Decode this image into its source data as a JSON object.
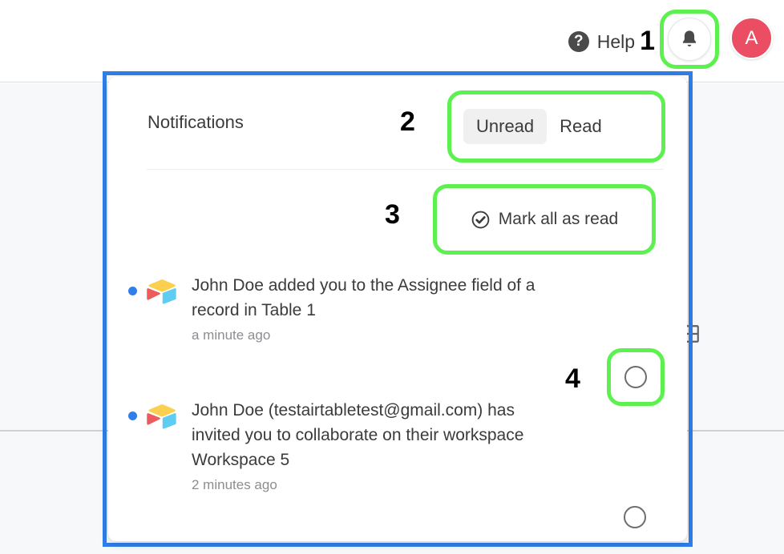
{
  "topbar": {
    "help_icon": "question-mark-circle-icon",
    "help_label": "Help",
    "step_1": "1",
    "bell_icon": "bell-icon",
    "avatar_initial": "A",
    "avatar_color": "#eb4d63"
  },
  "panel": {
    "title": "Notifications",
    "step_2": "2",
    "step_3": "3",
    "step_4": "4",
    "tabs": [
      {
        "label": "Unread",
        "active": true
      },
      {
        "label": "Read",
        "active": false
      }
    ],
    "mark_all_as_read": {
      "icon": "check-circle-icon",
      "label": "Mark all as read"
    },
    "notifications": [
      {
        "unread": true,
        "app_icon": "airtable-logo-icon",
        "message": "John Doe added you to the Assignee field of a record in Table 1",
        "time": "a minute ago",
        "action_icon": "mark-as-read-circle-icon"
      },
      {
        "unread": true,
        "app_icon": "airtable-logo-icon",
        "message": "John Doe (testairtabletest@gmail.com) has invited you to collaborate on their workspace Workspace 5",
        "time": "2 minutes ago",
        "action_icon": "mark-as-read-circle-icon"
      }
    ]
  },
  "colors": {
    "highlight_green": "#5cf14f",
    "highlight_blue": "#2f7eea",
    "unread_dot": "#2f7eea"
  }
}
